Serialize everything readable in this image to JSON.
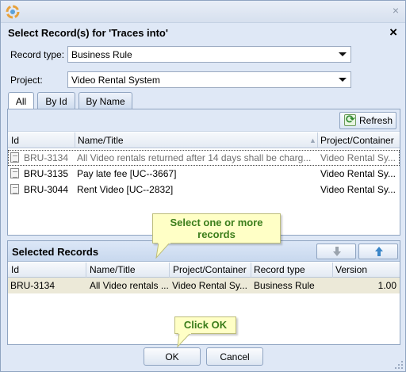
{
  "window": {
    "app_icon": "app-logo-icon",
    "close_glyph": "×"
  },
  "dialog": {
    "title": "Select Record(s) for 'Traces into'",
    "close_glyph": "×"
  },
  "record_type": {
    "label": "Record type:",
    "value": "Business Rule"
  },
  "project": {
    "label": "Project:",
    "value": "Video Rental System"
  },
  "tabs": [
    {
      "label": "All"
    },
    {
      "label": "By Id"
    },
    {
      "label": "By Name"
    }
  ],
  "toolbar": {
    "refresh_label": "Refresh"
  },
  "records_grid": {
    "columns": [
      "Id",
      "Name/Title",
      "Project/Container"
    ],
    "rows": [
      {
        "id": "BRU-3134",
        "name": "All Video rentals returned after 14 days shall be charg...",
        "project": "Video Rental Sy..."
      },
      {
        "id": "BRU-3135",
        "name": "Pay late fee [UC--3667]",
        "project": "Video Rental Sy..."
      },
      {
        "id": "BRU-3044",
        "name": "Rent Video [UC--2832]",
        "project": "Video Rental Sy..."
      }
    ]
  },
  "tooltip_select": {
    "text": "Select one or more records"
  },
  "selected_records": {
    "title": "Selected Records",
    "columns": [
      "Id",
      "Name/Title",
      "Project/Container",
      "Record type",
      "Version"
    ],
    "rows": [
      {
        "id": "BRU-3134",
        "name": "All Video rentals ...",
        "project": "Video Rental Sy...",
        "type": "Business Rule",
        "version": "1.00"
      }
    ]
  },
  "tooltip_ok": {
    "text": "Click OK"
  },
  "buttons": {
    "ok": "OK",
    "cancel": "Cancel"
  },
  "colors": {
    "accent": "#dfe8f6",
    "tooltip_bg": "#ffffc6",
    "tooltip_text": "#3b7d1b",
    "selected_row": "#ece9d8"
  }
}
